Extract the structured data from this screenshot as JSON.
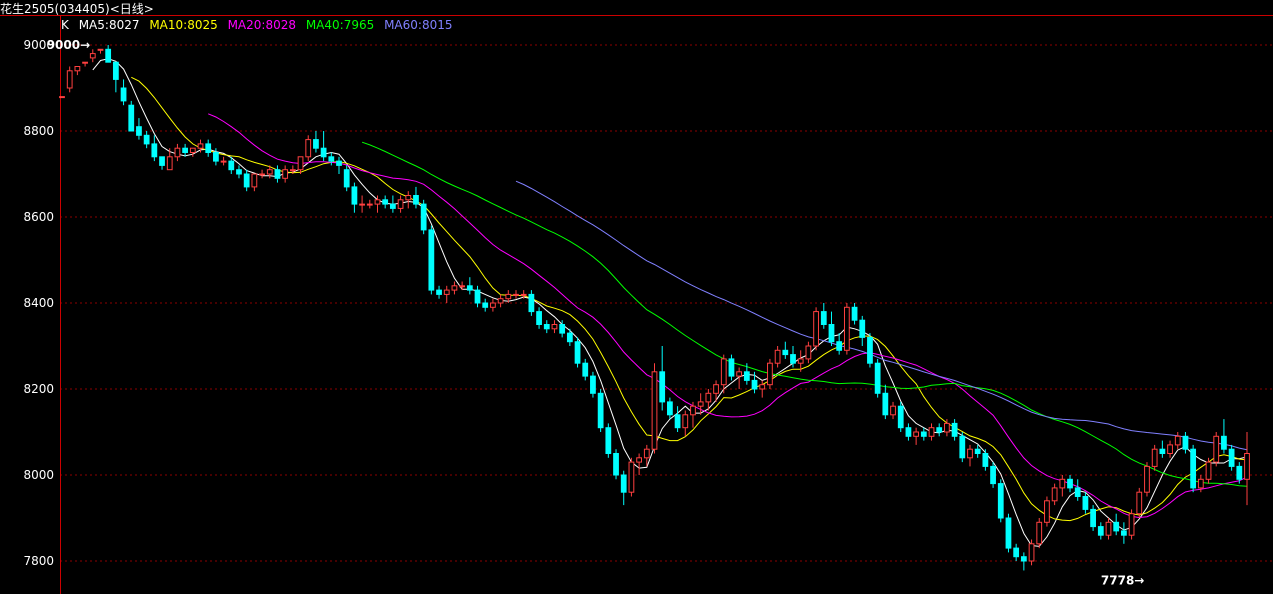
{
  "window": {
    "title": "花生2505(034405)<日线>"
  },
  "indicator": {
    "k_label": "K",
    "items": [
      {
        "text": "MA5:8027",
        "color": "#ffffff"
      },
      {
        "text": "MA10:8025",
        "color": "#ffff00"
      },
      {
        "text": "MA20:8028",
        "color": "#ff00ff"
      },
      {
        "text": "MA40:7965",
        "color": "#00ff00"
      },
      {
        "text": "MA60:8015",
        "color": "#8080ff"
      }
    ]
  },
  "colors": {
    "up": "#ff4040",
    "down": "#00ffff",
    "grid": "#8b0000",
    "axis": "#cc0000"
  },
  "chart_data": {
    "type": "candlestick",
    "ylim": [
      7760,
      9040
    ],
    "y_ticks": [
      7800,
      8000,
      8200,
      8400,
      8600,
      8800,
      9000
    ],
    "grid": true,
    "annotations": [
      {
        "text": "9000",
        "value": 9000,
        "bar_index": 6
      },
      {
        "text": "7778",
        "value": 7778,
        "bar_index": 143
      }
    ],
    "candles": [
      [
        8880,
        8880,
        8880,
        8880
      ],
      [
        8900,
        8950,
        8890,
        8940
      ],
      [
        8940,
        8950,
        8930,
        8950
      ],
      [
        8960,
        8960,
        8950,
        8960
      ],
      [
        8970,
        8990,
        8960,
        8980
      ],
      [
        8990,
        8990,
        8980,
        8990
      ],
      [
        8990,
        9000,
        8960,
        8960
      ],
      [
        8960,
        8960,
        8890,
        8920
      ],
      [
        8900,
        8920,
        8860,
        8870
      ],
      [
        8860,
        8870,
        8800,
        8800
      ],
      [
        8810,
        8830,
        8780,
        8790
      ],
      [
        8790,
        8800,
        8760,
        8770
      ],
      [
        8770,
        8790,
        8730,
        8740
      ],
      [
        8740,
        8740,
        8710,
        8720
      ],
      [
        8710,
        8760,
        8710,
        8740
      ],
      [
        8740,
        8770,
        8730,
        8760
      ],
      [
        8760,
        8770,
        8740,
        8750
      ],
      [
        8750,
        8760,
        8740,
        8760
      ],
      [
        8760,
        8780,
        8750,
        8770
      ],
      [
        8770,
        8780,
        8740,
        8750
      ],
      [
        8750,
        8760,
        8720,
        8730
      ],
      [
        8730,
        8740,
        8720,
        8730
      ],
      [
        8730,
        8740,
        8700,
        8710
      ],
      [
        8710,
        8720,
        8690,
        8700
      ],
      [
        8700,
        8710,
        8660,
        8670
      ],
      [
        8670,
        8700,
        8660,
        8700
      ],
      [
        8700,
        8710,
        8690,
        8700
      ],
      [
        8700,
        8720,
        8690,
        8710
      ],
      [
        8710,
        8720,
        8680,
        8690
      ],
      [
        8690,
        8720,
        8680,
        8710
      ],
      [
        8710,
        8720,
        8700,
        8710
      ],
      [
        8710,
        8740,
        8700,
        8740
      ],
      [
        8740,
        8790,
        8730,
        8780
      ],
      [
        8780,
        8800,
        8750,
        8760
      ],
      [
        8760,
        8800,
        8730,
        8740
      ],
      [
        8740,
        8750,
        8720,
        8730
      ],
      [
        8730,
        8740,
        8700,
        8720
      ],
      [
        8710,
        8720,
        8660,
        8670
      ],
      [
        8670,
        8680,
        8610,
        8630
      ],
      [
        8630,
        8650,
        8610,
        8630
      ],
      [
        8630,
        8640,
        8620,
        8630
      ],
      [
        8630,
        8650,
        8610,
        8640
      ],
      [
        8640,
        8650,
        8620,
        8630
      ],
      [
        8630,
        8650,
        8610,
        8620
      ],
      [
        8620,
        8650,
        8610,
        8640
      ],
      [
        8640,
        8660,
        8620,
        8650
      ],
      [
        8650,
        8670,
        8620,
        8630
      ],
      [
        8630,
        8640,
        8560,
        8570
      ],
      [
        8570,
        8580,
        8420,
        8430
      ],
      [
        8430,
        8440,
        8410,
        8420
      ],
      [
        8420,
        8440,
        8400,
        8430
      ],
      [
        8430,
        8450,
        8420,
        8440
      ],
      [
        8440,
        8450,
        8430,
        8440
      ],
      [
        8440,
        8460,
        8420,
        8430
      ],
      [
        8430,
        8440,
        8390,
        8400
      ],
      [
        8400,
        8410,
        8380,
        8390
      ],
      [
        8390,
        8410,
        8380,
        8400
      ],
      [
        8400,
        8420,
        8390,
        8410
      ],
      [
        8410,
        8430,
        8400,
        8420
      ],
      [
        8420,
        8430,
        8410,
        8420
      ],
      [
        8420,
        8430,
        8410,
        8420
      ],
      [
        8420,
        8430,
        8370,
        8380
      ],
      [
        8380,
        8390,
        8340,
        8350
      ],
      [
        8350,
        8360,
        8330,
        8340
      ],
      [
        8340,
        8360,
        8330,
        8350
      ],
      [
        8350,
        8360,
        8320,
        8330
      ],
      [
        8330,
        8340,
        8300,
        8310
      ],
      [
        8310,
        8320,
        8250,
        8260
      ],
      [
        8260,
        8270,
        8220,
        8230
      ],
      [
        8230,
        8240,
        8180,
        8190
      ],
      [
        8190,
        8200,
        8100,
        8110
      ],
      [
        8110,
        8120,
        8040,
        8050
      ],
      [
        8050,
        8060,
        7990,
        8000
      ],
      [
        8000,
        8010,
        7930,
        7960
      ],
      [
        7960,
        8040,
        7950,
        8030
      ],
      [
        8030,
        8050,
        8000,
        8040
      ],
      [
        8040,
        8070,
        8020,
        8060
      ],
      [
        8060,
        8260,
        8050,
        8240
      ],
      [
        8240,
        8300,
        8150,
        8170
      ],
      [
        8170,
        8180,
        8130,
        8140
      ],
      [
        8140,
        8160,
        8100,
        8110
      ],
      [
        8110,
        8150,
        8090,
        8140
      ],
      [
        8140,
        8170,
        8110,
        8160
      ],
      [
        8160,
        8190,
        8140,
        8170
      ],
      [
        8170,
        8200,
        8150,
        8190
      ],
      [
        8190,
        8220,
        8170,
        8210
      ],
      [
        8210,
        8280,
        8190,
        8270
      ],
      [
        8270,
        8280,
        8220,
        8230
      ],
      [
        8230,
        8250,
        8200,
        8240
      ],
      [
        8240,
        8260,
        8210,
        8220
      ],
      [
        8220,
        8240,
        8190,
        8200
      ],
      [
        8200,
        8220,
        8180,
        8210
      ],
      [
        8210,
        8270,
        8200,
        8260
      ],
      [
        8260,
        8300,
        8250,
        8290
      ],
      [
        8290,
        8310,
        8270,
        8280
      ],
      [
        8280,
        8300,
        8250,
        8260
      ],
      [
        8260,
        8290,
        8240,
        8270
      ],
      [
        8270,
        8310,
        8260,
        8300
      ],
      [
        8300,
        8390,
        8290,
        8380
      ],
      [
        8380,
        8400,
        8340,
        8350
      ],
      [
        8350,
        8380,
        8300,
        8310
      ],
      [
        8310,
        8330,
        8280,
        8290
      ],
      [
        8290,
        8400,
        8280,
        8390
      ],
      [
        8390,
        8400,
        8350,
        8360
      ],
      [
        8360,
        8370,
        8300,
        8320
      ],
      [
        8320,
        8330,
        8250,
        8260
      ],
      [
        8260,
        8270,
        8180,
        8190
      ],
      [
        8190,
        8210,
        8130,
        8140
      ],
      [
        8140,
        8170,
        8130,
        8160
      ],
      [
        8160,
        8170,
        8100,
        8110
      ],
      [
        8110,
        8120,
        8080,
        8090
      ],
      [
        8090,
        8110,
        8070,
        8100
      ],
      [
        8100,
        8110,
        8080,
        8090
      ],
      [
        8090,
        8120,
        8080,
        8110
      ],
      [
        8110,
        8120,
        8090,
        8100
      ],
      [
        8100,
        8130,
        8090,
        8120
      ],
      [
        8120,
        8130,
        8080,
        8090
      ],
      [
        8090,
        8100,
        8030,
        8040
      ],
      [
        8040,
        8070,
        8020,
        8060
      ],
      [
        8060,
        8070,
        8040,
        8050
      ],
      [
        8050,
        8060,
        8010,
        8020
      ],
      [
        8020,
        8030,
        7970,
        7980
      ],
      [
        7980,
        7990,
        7890,
        7900
      ],
      [
        7900,
        7910,
        7820,
        7830
      ],
      [
        7830,
        7840,
        7800,
        7810
      ],
      [
        7810,
        7820,
        7778,
        7800
      ],
      [
        7800,
        7850,
        7790,
        7840
      ],
      [
        7840,
        7900,
        7830,
        7890
      ],
      [
        7890,
        7950,
        7880,
        7940
      ],
      [
        7940,
        7980,
        7930,
        7970
      ],
      [
        7970,
        8000,
        7950,
        7990
      ],
      [
        7990,
        8000,
        7960,
        7970
      ],
      [
        7970,
        7990,
        7940,
        7950
      ],
      [
        7950,
        7960,
        7910,
        7920
      ],
      [
        7920,
        7930,
        7870,
        7880
      ],
      [
        7880,
        7890,
        7850,
        7860
      ],
      [
        7860,
        7900,
        7850,
        7890
      ],
      [
        7890,
        7910,
        7860,
        7870
      ],
      [
        7870,
        7890,
        7840,
        7860
      ],
      [
        7860,
        7920,
        7850,
        7910
      ],
      [
        7910,
        7970,
        7900,
        7960
      ],
      [
        7960,
        8030,
        7950,
        8020
      ],
      [
        8020,
        8070,
        8010,
        8060
      ],
      [
        8060,
        8080,
        8040,
        8050
      ],
      [
        8050,
        8080,
        8040,
        8070
      ],
      [
        8070,
        8100,
        8060,
        8090
      ],
      [
        8090,
        8100,
        8050,
        8060
      ],
      [
        8060,
        8070,
        7960,
        7970
      ],
      [
        7970,
        8000,
        7960,
        7990
      ],
      [
        7990,
        8040,
        7980,
        8030
      ],
      [
        8030,
        8100,
        8020,
        8090
      ],
      [
        8090,
        8130,
        8050,
        8060
      ],
      [
        8060,
        8070,
        8010,
        8020
      ],
      [
        8020,
        8030,
        7980,
        7990
      ],
      [
        7990,
        8100,
        7930,
        8050
      ]
    ]
  }
}
